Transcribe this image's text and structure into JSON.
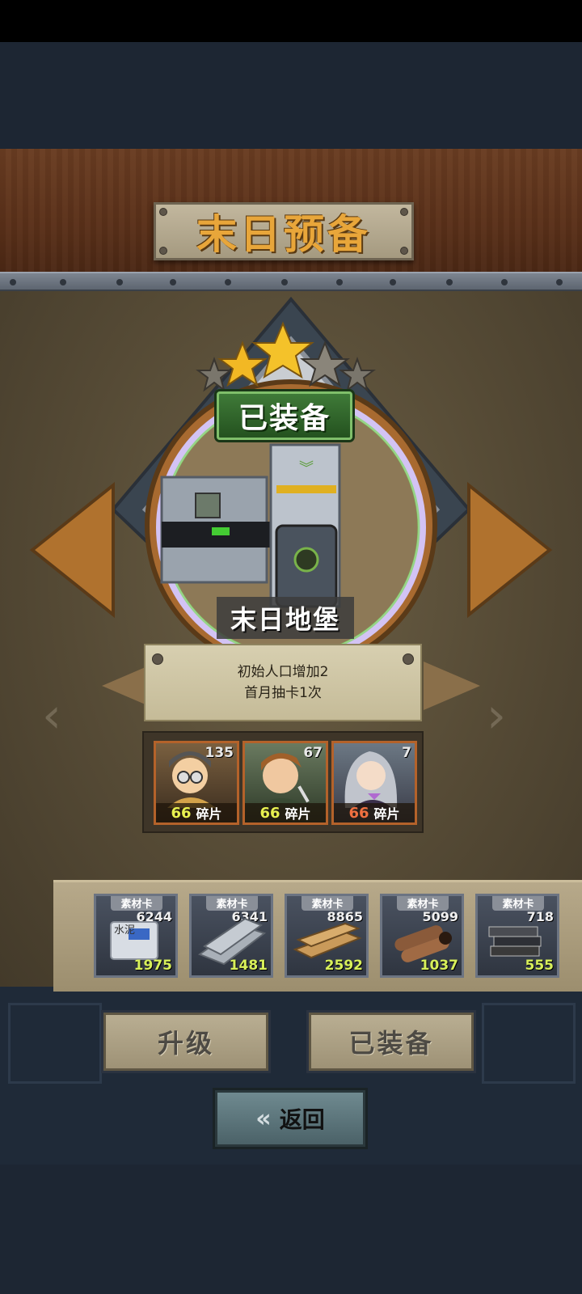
{
  "header": {
    "title": "末日预备"
  },
  "building": {
    "status_badge": "已装备",
    "name": "末日地堡",
    "stars_filled": 2,
    "stars_total": 5,
    "description": [
      "初始人口增加2",
      "首月抽卡1次"
    ]
  },
  "heroes": [
    {
      "count": "135",
      "fragments": "66",
      "label": "碎片",
      "frag_color": "#e8f050"
    },
    {
      "count": "67",
      "fragments": "66",
      "label": "碎片",
      "frag_color": "#e8f050"
    },
    {
      "count": "7",
      "fragments": "66",
      "label": "碎片",
      "frag_color": "#f07040"
    }
  ],
  "materials": [
    {
      "tag": "素材卡",
      "owned": "6244",
      "required": "1975",
      "icon": "cement-bag-icon",
      "icon_text": "水泥"
    },
    {
      "tag": "素材卡",
      "owned": "6341",
      "required": "1481",
      "icon": "steel-plate-icon"
    },
    {
      "tag": "素材卡",
      "owned": "8865",
      "required": "2592",
      "icon": "wood-plank-icon"
    },
    {
      "tag": "素材卡",
      "owned": "5099",
      "required": "1037",
      "icon": "pipe-icon"
    },
    {
      "tag": "素材卡",
      "owned": "718",
      "required": "555",
      "icon": "book-stack-icon"
    }
  ],
  "actions": {
    "upgrade": "升级",
    "equipped": "已装备",
    "back": "返回"
  },
  "colors": {
    "wood": "#5a3019",
    "badge_green": "#3f7a38",
    "gold": "#e8a63a"
  }
}
